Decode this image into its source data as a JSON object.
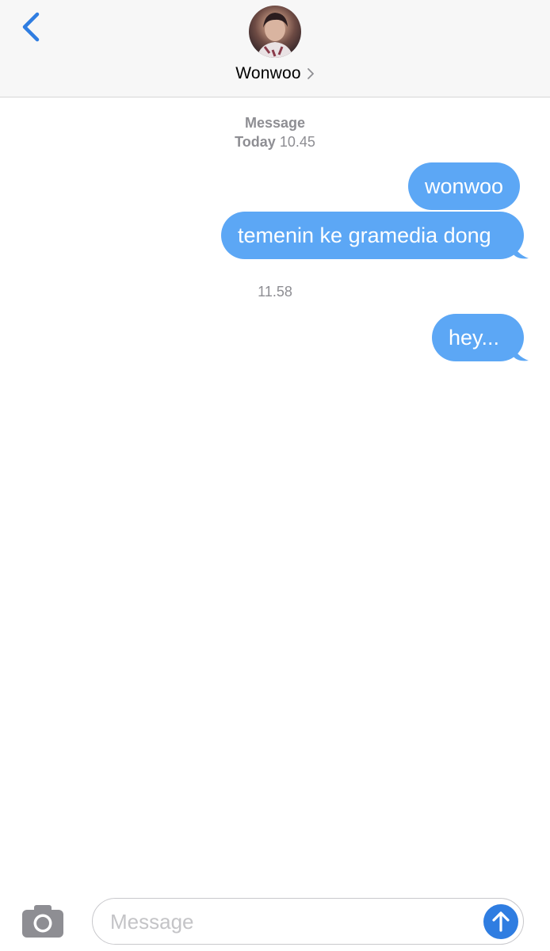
{
  "header": {
    "contact_name": "Wonwoo",
    "back_icon": "chevron-left-icon",
    "chevron_icon": "chevron-right-icon"
  },
  "timestamps": {
    "top_label": "Message",
    "top_day": "Today",
    "top_time": "10.45",
    "middle_time": "11.58"
  },
  "messages": [
    {
      "text": "wonwoo",
      "sender": "me"
    },
    {
      "text": "temenin ke gramedia dong",
      "sender": "me"
    },
    {
      "text": "hey...",
      "sender": "me"
    }
  ],
  "composer": {
    "placeholder": "Message",
    "camera_icon": "camera-icon",
    "send_icon": "arrow-up-icon"
  },
  "colors": {
    "accent": "#2f7de1",
    "bubble": "#5ca7f5",
    "header_bg": "#f7f7f7",
    "timestamp": "#8e8e93"
  }
}
